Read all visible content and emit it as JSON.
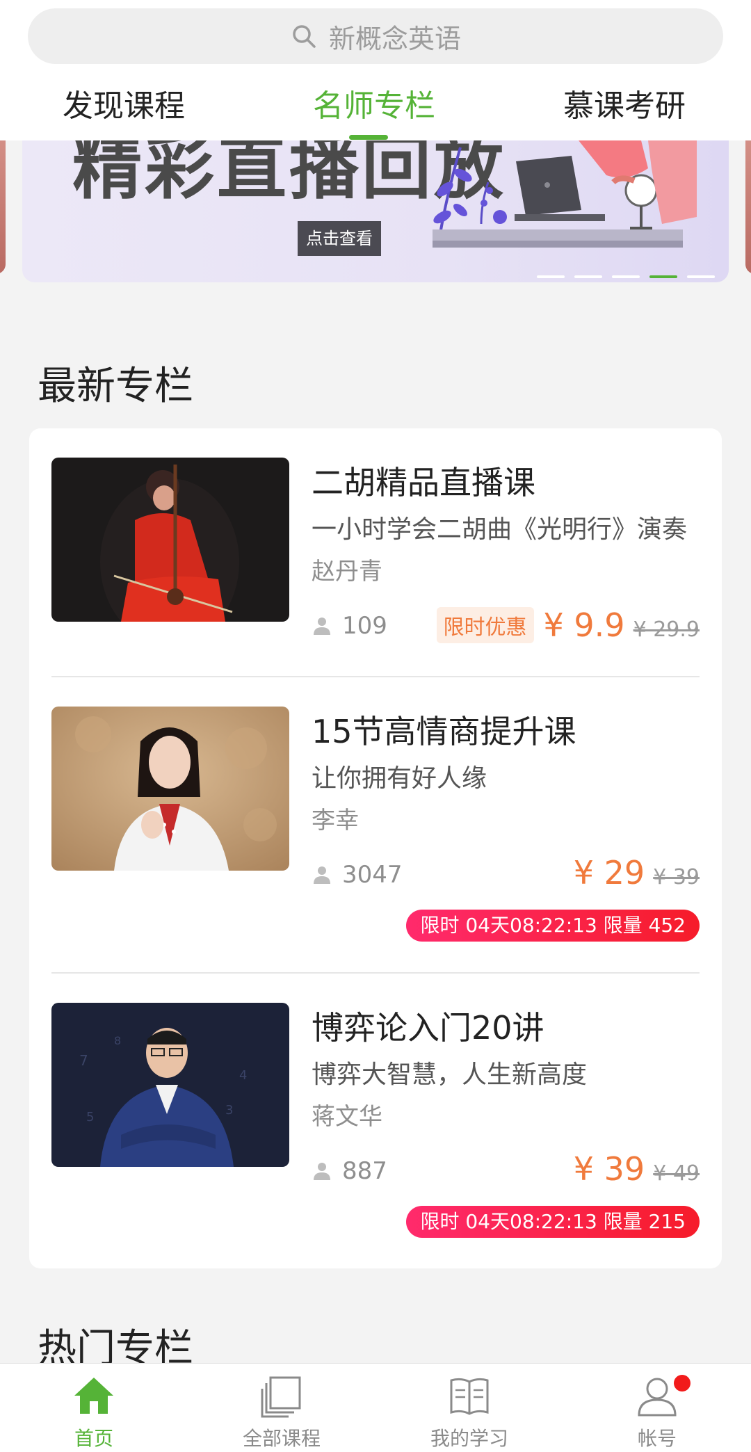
{
  "search": {
    "placeholder": "新概念英语"
  },
  "tabs": [
    {
      "label": "发现课程",
      "active": false
    },
    {
      "label": "名师专栏",
      "active": true
    },
    {
      "label": "慕课考研",
      "active": false
    }
  ],
  "banner": {
    "title": "精彩直播回放",
    "button_label": "点击查看",
    "slide_count": 5,
    "active_slide": 4
  },
  "latest_section": {
    "title": "最新专栏"
  },
  "courses": [
    {
      "title": "二胡精品直播课",
      "subtitle": "一小时学会二胡曲《光明行》演奏",
      "teacher": "赵丹青",
      "count": "109",
      "promo_tag": "限时优惠",
      "price": "¥ 9.9",
      "original_price": "¥ 29.9",
      "limit": ""
    },
    {
      "title": "15节高情商提升课",
      "subtitle": "让你拥有好人缘",
      "teacher": "李幸",
      "count": "3047",
      "promo_tag": "",
      "price": "¥ 29",
      "original_price": "¥ 39",
      "limit": "限时 04天08:22:13   限量 452"
    },
    {
      "title": "博弈论入门20讲",
      "subtitle": "博弈大智慧，人生新高度",
      "teacher": "蒋文华",
      "count": "887",
      "promo_tag": "",
      "price": "¥ 39",
      "original_price": "¥ 49",
      "limit": "限时 04天08:22:13   限量 215"
    }
  ],
  "hot_section": {
    "title": "热门专栏"
  },
  "bottom_nav": [
    {
      "label": "首页",
      "icon": "home-icon",
      "active": true
    },
    {
      "label": "全部课程",
      "icon": "courses-icon",
      "active": false
    },
    {
      "label": "我的学习",
      "icon": "book-icon",
      "active": false
    },
    {
      "label": "帐号",
      "icon": "user-icon",
      "active": false,
      "has_notification": true
    }
  ],
  "colors": {
    "accent": "#55b337",
    "price": "#f07a3c",
    "badge_start": "#ff2a6c",
    "badge_end": "#f61c2a",
    "background": "#f3f3f3"
  }
}
